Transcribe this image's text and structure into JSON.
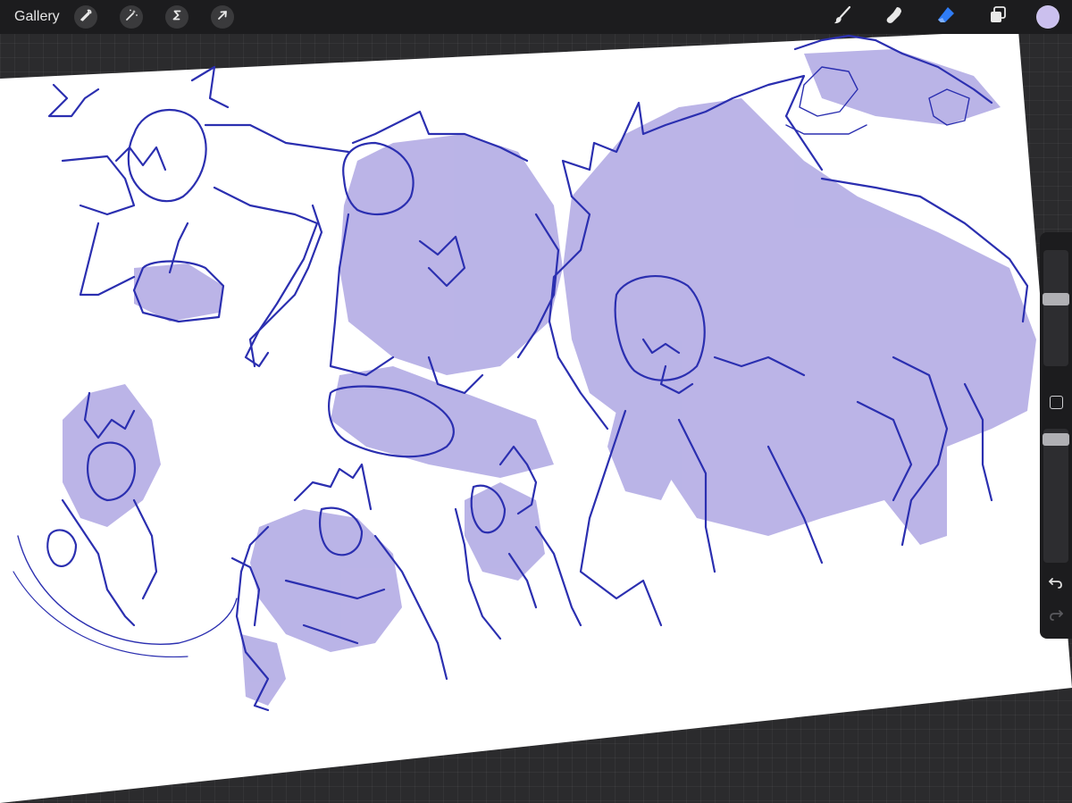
{
  "toolbar": {
    "gallery_label": "Gallery",
    "left_tools": [
      {
        "name": "wrench-icon",
        "role": "actions"
      },
      {
        "name": "magic-wand-icon",
        "role": "adjustments"
      },
      {
        "name": "selection-s-icon",
        "role": "selection"
      },
      {
        "name": "arrow-cursor-icon",
        "role": "transform"
      }
    ],
    "right_tools": [
      {
        "name": "brush-icon",
        "role": "paint"
      },
      {
        "name": "smudge-icon",
        "role": "smudge"
      },
      {
        "name": "eraser-icon",
        "role": "erase",
        "active": true
      },
      {
        "name": "layers-icon",
        "role": "layers"
      }
    ],
    "current_color": "#cbc0ee",
    "active_tool_color": "#2f7cf6"
  },
  "sidebar": {
    "brush_size_level": 0.18,
    "opacity_level": 0.05,
    "icons": [
      "modify-square-icon",
      "undo-icon",
      "redo-icon"
    ]
  },
  "canvas": {
    "paper_color": "#ffffff",
    "line_color": "#2b2fb0",
    "shade_color": "#b4aee4"
  }
}
